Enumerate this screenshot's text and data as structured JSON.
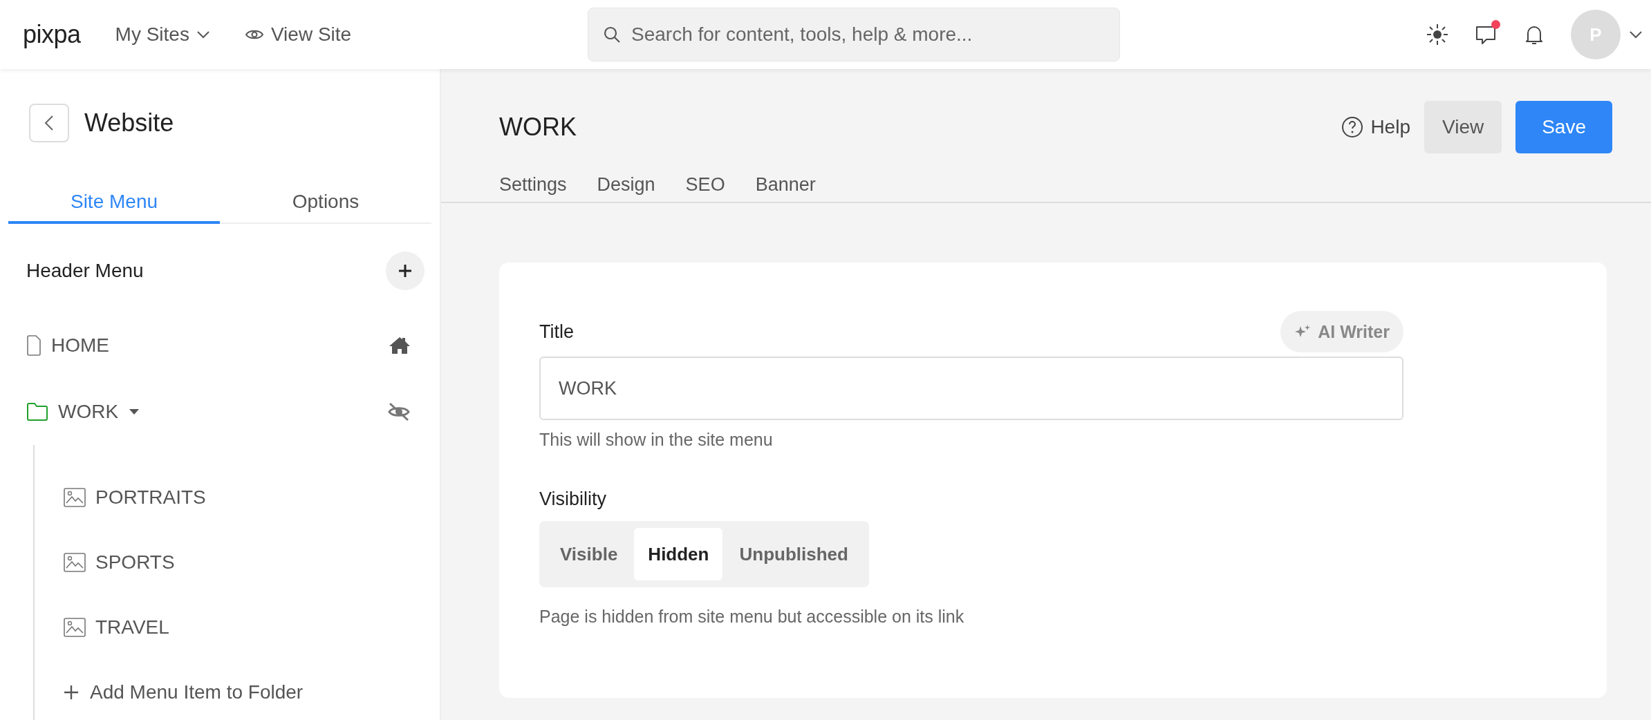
{
  "topbar": {
    "logo": "pixpa",
    "my_sites": "My Sites",
    "view_site": "View Site",
    "search": {
      "placeholder": "Search for content, tools, help & more..."
    },
    "messages_unread": true,
    "avatar": "P"
  },
  "sidebar": {
    "title": "Website",
    "tabs": [
      {
        "label": "Site Menu",
        "selected": true
      },
      {
        "label": "Options",
        "selected": false
      }
    ],
    "section": "Header Menu",
    "items": [
      {
        "label": "HOME",
        "kind": "page",
        "is_home": true,
        "hidden": false
      },
      {
        "label": "WORK",
        "kind": "folder",
        "is_home": false,
        "hidden": true,
        "expanded": true,
        "children": [
          {
            "label": "PORTRAITS",
            "kind": "gallery"
          },
          {
            "label": "SPORTS",
            "kind": "gallery"
          },
          {
            "label": "TRAVEL",
            "kind": "gallery"
          }
        ],
        "add_label": "Add Menu Item to Folder"
      }
    ]
  },
  "main": {
    "title": "WORK",
    "help": "Help",
    "view": "View",
    "save": "Save",
    "tabs": [
      {
        "label": "Settings",
        "selected": false
      },
      {
        "label": "Design",
        "selected": false
      },
      {
        "label": "SEO",
        "selected": false
      },
      {
        "label": "Banner",
        "selected": false
      }
    ],
    "title_field": {
      "label": "Title",
      "ai_writer": "AI Writer",
      "value": "WORK",
      "hint": "This will show in the site menu"
    },
    "visibility": {
      "label": "Visibility",
      "options": [
        {
          "label": "Visible",
          "selected": false
        },
        {
          "label": "Hidden",
          "selected": true
        },
        {
          "label": "Unpublished",
          "selected": false
        }
      ],
      "hint": "Page is hidden from site menu but accessible on its link"
    }
  }
}
